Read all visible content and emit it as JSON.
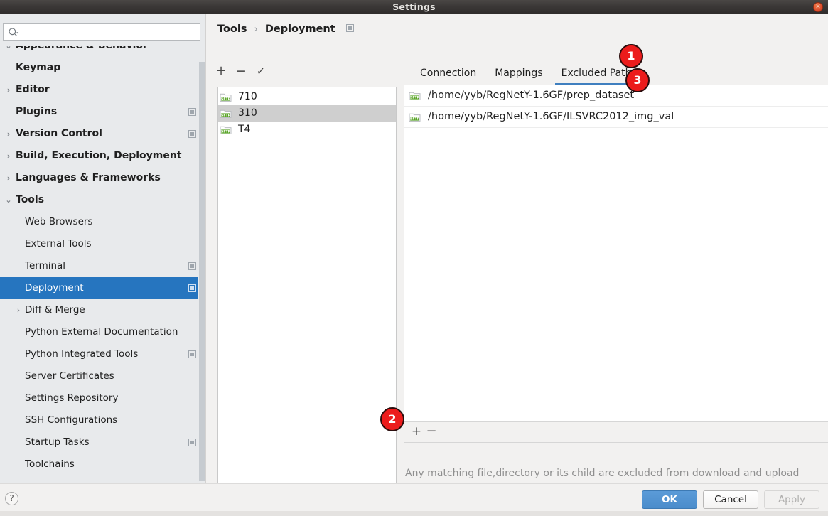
{
  "window": {
    "title": "Settings",
    "close_icon": "close-icon"
  },
  "sidebar": {
    "search": {
      "value": "",
      "placeholder": "",
      "icon": "search-icon"
    },
    "items": [
      {
        "label": "Appearance & Behavior",
        "level": "top",
        "arrow": "⌄",
        "badge": false,
        "selected": false
      },
      {
        "label": "Keymap",
        "level": "top",
        "arrow": "",
        "badge": false,
        "selected": false
      },
      {
        "label": "Editor",
        "level": "top",
        "arrow": "›",
        "badge": false,
        "selected": false
      },
      {
        "label": "Plugins",
        "level": "top",
        "arrow": "",
        "badge": true,
        "selected": false
      },
      {
        "label": "Version Control",
        "level": "top",
        "arrow": "›",
        "badge": true,
        "selected": false
      },
      {
        "label": "Build, Execution, Deployment",
        "level": "top",
        "arrow": "›",
        "badge": false,
        "selected": false
      },
      {
        "label": "Languages & Frameworks",
        "level": "top",
        "arrow": "›",
        "badge": false,
        "selected": false
      },
      {
        "label": "Tools",
        "level": "top",
        "arrow": "⌄",
        "badge": false,
        "selected": false
      },
      {
        "label": "Web Browsers",
        "level": "child",
        "arrow": "",
        "badge": false,
        "selected": false
      },
      {
        "label": "External Tools",
        "level": "child",
        "arrow": "",
        "badge": false,
        "selected": false
      },
      {
        "label": "Terminal",
        "level": "child",
        "arrow": "",
        "badge": true,
        "selected": false
      },
      {
        "label": "Deployment",
        "level": "child",
        "arrow": "",
        "badge": true,
        "selected": true
      },
      {
        "label": "Diff & Merge",
        "level": "child",
        "arrow": "›",
        "badge": false,
        "selected": false
      },
      {
        "label": "Python External Documentation",
        "level": "child",
        "arrow": "",
        "badge": false,
        "selected": false
      },
      {
        "label": "Python Integrated Tools",
        "level": "child",
        "arrow": "",
        "badge": true,
        "selected": false
      },
      {
        "label": "Server Certificates",
        "level": "child",
        "arrow": "",
        "badge": false,
        "selected": false
      },
      {
        "label": "Settings Repository",
        "level": "child",
        "arrow": "",
        "badge": false,
        "selected": false
      },
      {
        "label": "SSH Configurations",
        "level": "child",
        "arrow": "",
        "badge": false,
        "selected": false
      },
      {
        "label": "Startup Tasks",
        "level": "child",
        "arrow": "",
        "badge": true,
        "selected": false
      },
      {
        "label": "Toolchains",
        "level": "child",
        "arrow": "",
        "badge": false,
        "selected": false
      }
    ]
  },
  "breadcrumb": {
    "parent": "Tools",
    "separator": "›",
    "current": "Deployment"
  },
  "server_toolbar": {
    "add": "+",
    "remove": "−",
    "set_default": "✓"
  },
  "servers": [
    {
      "name": "710",
      "icon": "sftp-icon",
      "selected": false
    },
    {
      "name": "310",
      "icon": "sftp-icon",
      "selected": true
    },
    {
      "name": "T4",
      "icon": "sftp-icon",
      "selected": false
    }
  ],
  "tabs": [
    {
      "label": "Connection",
      "active": false
    },
    {
      "label": "Mappings",
      "active": false
    },
    {
      "label": "Excluded Paths",
      "active": true
    }
  ],
  "excluded_paths": [
    {
      "path": "/home/yyb/RegNetY-1.6GF/prep_dataset",
      "icon": "sftp-icon"
    },
    {
      "path": "/home/yyb/RegNetY-1.6GF/ILSVRC2012_img_val",
      "icon": "sftp-icon"
    }
  ],
  "paths_toolbar": {
    "add": "+",
    "remove": "−"
  },
  "hint": "Any matching file,directory or its child are excluded from download and upload",
  "footer": {
    "help": "?",
    "ok": "OK",
    "cancel": "Cancel",
    "apply": "Apply"
  },
  "annotations": [
    {
      "number": "1"
    },
    {
      "number": "2"
    },
    {
      "number": "3"
    }
  ],
  "colors": {
    "selection_blue": "#2675bf",
    "tab_underline": "#3f7fbf",
    "marker_red": "#ec1c1c",
    "sftp_green": "#5aa528",
    "ok_blue": "#4a8ccb"
  }
}
